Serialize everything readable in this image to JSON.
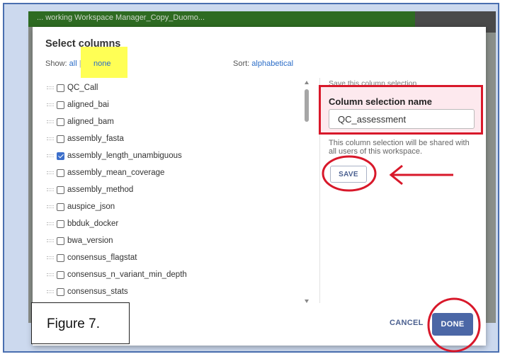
{
  "app": {
    "header_text": "... working Workspace Manager_Copy_Duomo..."
  },
  "modal": {
    "title": "Select columns",
    "show_label": "Show:",
    "show_all": "all",
    "show_sep": "|",
    "show_none": "none",
    "sort_label": "Sort:",
    "sort_value": "alphabetical",
    "columns": [
      {
        "label": "QC_Call",
        "checked": false
      },
      {
        "label": "aligned_bai",
        "checked": false
      },
      {
        "label": "aligned_bam",
        "checked": false
      },
      {
        "label": "assembly_fasta",
        "checked": false
      },
      {
        "label": "assembly_length_unambiguous",
        "checked": true
      },
      {
        "label": "assembly_mean_coverage",
        "checked": false
      },
      {
        "label": "assembly_method",
        "checked": false
      },
      {
        "label": "auspice_json",
        "checked": false
      },
      {
        "label": "bbduk_docker",
        "checked": false
      },
      {
        "label": "bwa_version",
        "checked": false
      },
      {
        "label": "consensus_flagstat",
        "checked": false
      },
      {
        "label": "consensus_n_variant_min_depth",
        "checked": false
      },
      {
        "label": "consensus_stats",
        "checked": false
      }
    ],
    "save_section_label": "Save this column selection",
    "column_selection_name_label": "Column selection name",
    "column_selection_name_value": "QC_assessment",
    "share_note": "This column selection will be shared with all users of this workspace.",
    "save_button": "SAVE",
    "cancel_button": "CANCEL",
    "done_button": "DONE"
  },
  "figure_caption": "Figure 7.",
  "colors": {
    "accent_blue": "#4b67a6",
    "link_blue": "#2a6cc7",
    "annotation_red": "#d8182a",
    "highlight_yellow": "#ffff55",
    "header_green": "#2e6b22",
    "frame_blue": "#ccd9ee"
  }
}
